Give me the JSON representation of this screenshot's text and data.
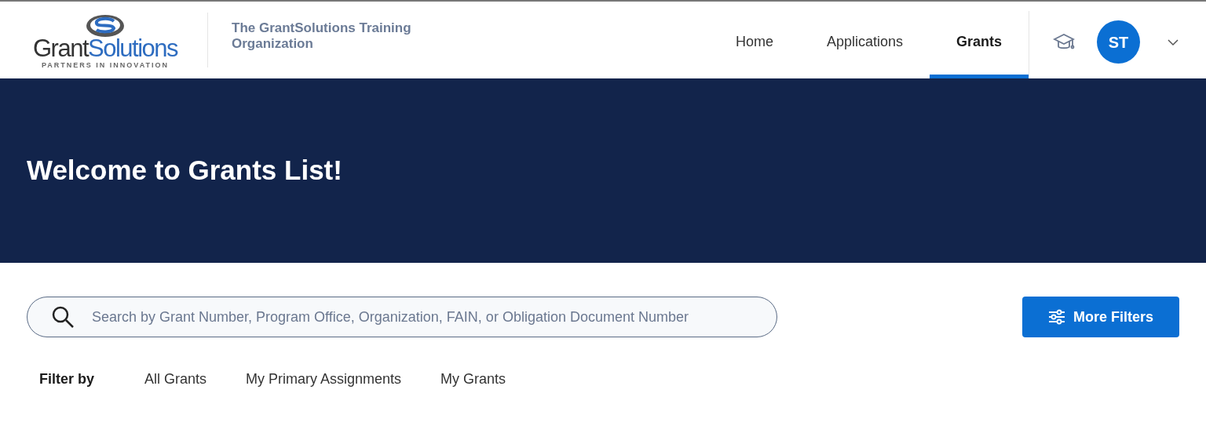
{
  "logo": {
    "word_1": "Grant",
    "word_2": "Solutions",
    "tagline": "PARTNERS IN INNOVATION"
  },
  "organization": "The GrantSolutions Training Organization",
  "nav": [
    {
      "label": "Home",
      "selected": false
    },
    {
      "label": "Applications",
      "selected": false
    },
    {
      "label": "Grants",
      "selected": true
    }
  ],
  "user": {
    "initials": "ST"
  },
  "banner": {
    "title": "Welcome to Grants List!"
  },
  "search": {
    "placeholder": "Search by Grant Number, Program Office, Organization, FAIN, or Obligation Document Number"
  },
  "more_filters_button": "More Filters",
  "filter": {
    "label": "Filter by",
    "options": [
      "All Grants",
      "My Primary Assignments",
      "My Grants"
    ]
  }
}
